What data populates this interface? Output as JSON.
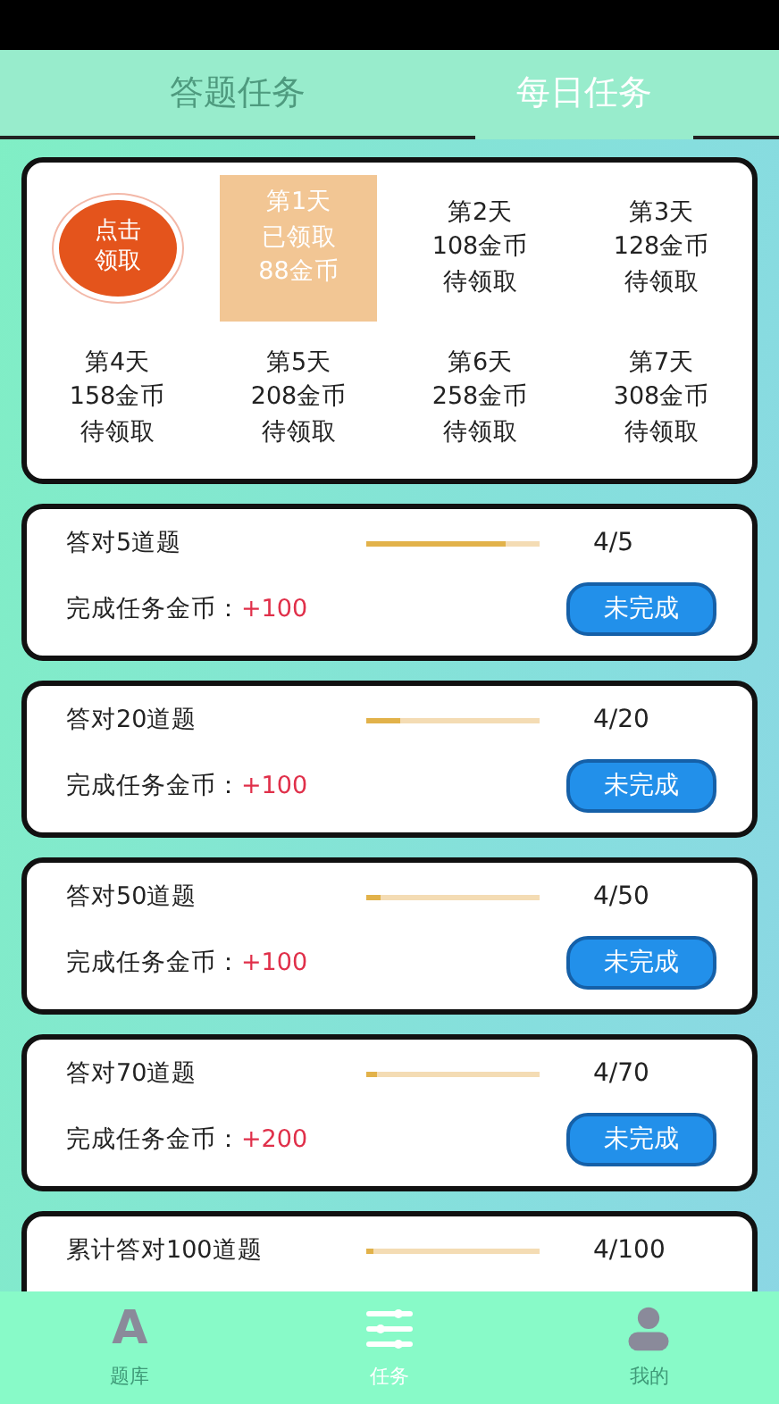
{
  "tabs": [
    {
      "label": "答题任务",
      "selected": false
    },
    {
      "label": "每日任务",
      "selected": true
    }
  ],
  "checkin": {
    "claim_button": "点击领取",
    "days": [
      {
        "day": "第1天",
        "line2": "已领取",
        "line3": "88金币",
        "claimed": true
      },
      {
        "day": "第2天",
        "line2": "108金币",
        "line3": "待领取",
        "claimed": false
      },
      {
        "day": "第3天",
        "line2": "128金币",
        "line3": "待领取",
        "claimed": false
      },
      {
        "day": "第4天",
        "line2": "158金币",
        "line3": "待领取",
        "claimed": false
      },
      {
        "day": "第5天",
        "line2": "208金币",
        "line3": "待领取",
        "claimed": false
      },
      {
        "day": "第6天",
        "line2": "258金币",
        "line3": "待领取",
        "claimed": false
      },
      {
        "day": "第7天",
        "line2": "308金币",
        "line3": "待领取",
        "claimed": false
      }
    ]
  },
  "tasks": [
    {
      "title": "答对5道题",
      "level": 0.8,
      "progress": "4/5",
      "reward_label": "完成任务金币：",
      "reward": "+100",
      "button": "未完成"
    },
    {
      "title": "答对20道题",
      "level": 0.2,
      "progress": "4/20",
      "reward_label": "完成任务金币：",
      "reward": "+100",
      "button": "未完成"
    },
    {
      "title": "答对50道题",
      "level": 0.08,
      "progress": "4/50",
      "reward_label": "完成任务金币：",
      "reward": "+100",
      "button": "未完成"
    },
    {
      "title": "答对70道题",
      "level": 0.06,
      "progress": "4/70",
      "reward_label": "完成任务金币：",
      "reward": "+200",
      "button": "未完成"
    },
    {
      "title": "累计答对100道题",
      "level": 0.04,
      "progress": "4/100"
    }
  ],
  "nav": [
    {
      "kind": "letter",
      "glyph": "A",
      "label": "题库",
      "selected": false
    },
    {
      "kind": "sliders",
      "label": "任务",
      "selected": true
    },
    {
      "kind": "person",
      "label": "我的",
      "selected": false
    }
  ]
}
